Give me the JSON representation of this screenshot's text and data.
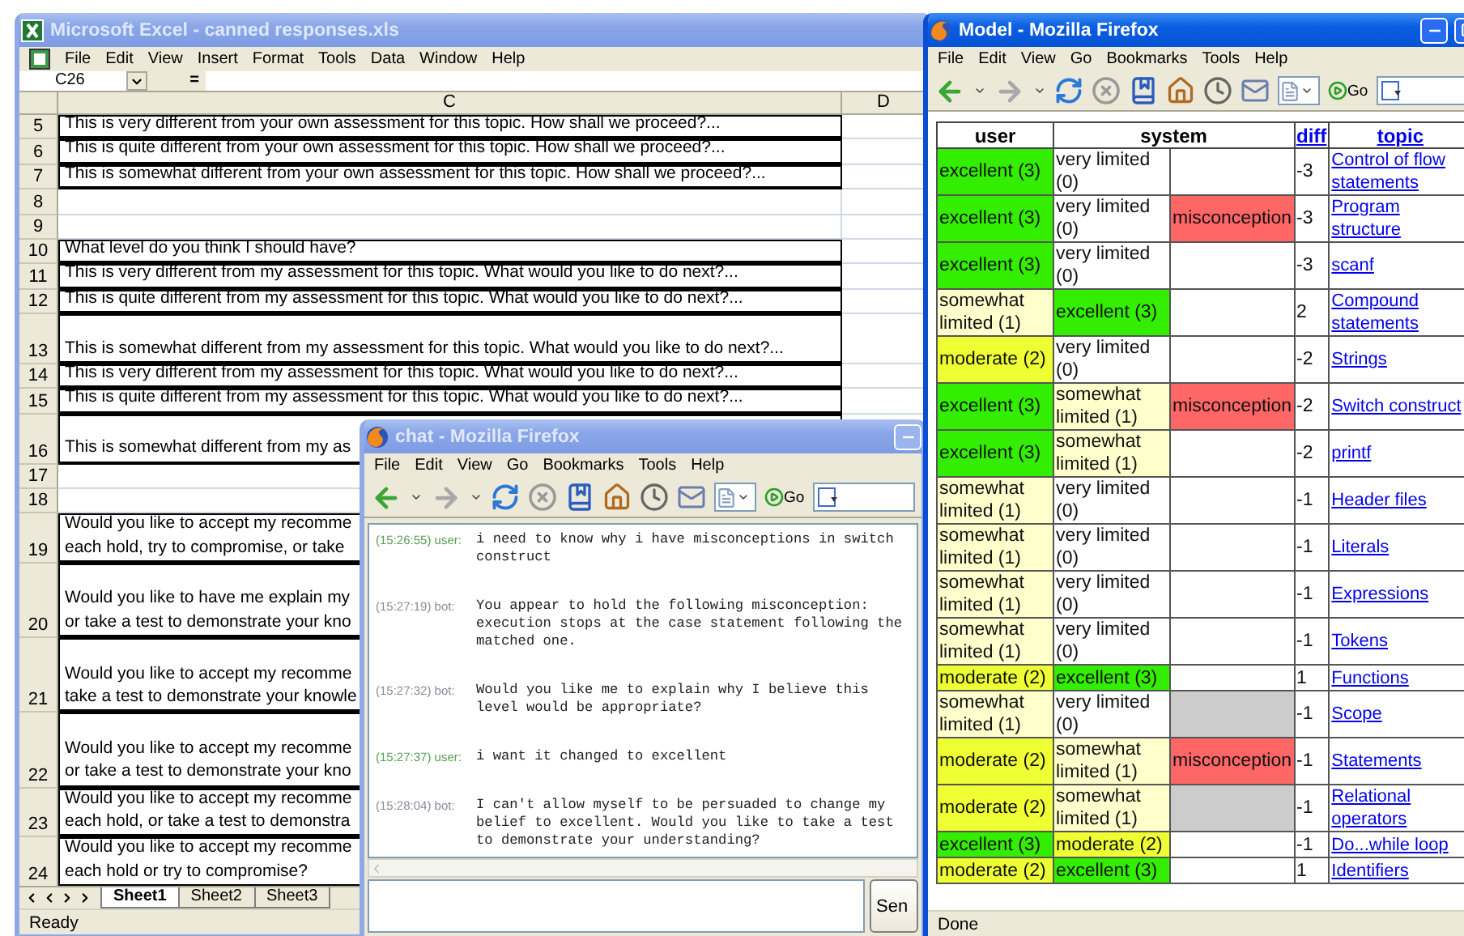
{
  "excel": {
    "title": "Microsoft Excel - canned responses.xls",
    "menu": [
      "File",
      "Edit",
      "View",
      "Insert",
      "Format",
      "Tools",
      "Data",
      "Window",
      "Help"
    ],
    "name_box": "C26",
    "formula_sign": "=",
    "columns": [
      "C",
      "D"
    ],
    "rows": [
      {
        "number": "5",
        "kind": "plain",
        "lines": [
          "This is very different from your own assessment for this topic. How shall we proceed?..."
        ]
      },
      {
        "number": "6",
        "kind": "plain",
        "lines": [
          "This is quite different from your own assessment for this topic. How shall we proceed?..."
        ]
      },
      {
        "number": "7",
        "kind": "plain",
        "lines": [
          "This is somewhat different from your own assessment for this topic. How shall we proceed?..."
        ]
      },
      {
        "number": "8",
        "kind": "plain"
      },
      {
        "number": "9",
        "kind": "plain"
      },
      {
        "number": "10",
        "kind": "plain",
        "lines": [
          "What level do you think I should have?"
        ]
      },
      {
        "number": "11",
        "kind": "plain",
        "lines": [
          "This is very different from my assessment for this topic. What would you like to do next?..."
        ]
      },
      {
        "number": "12",
        "kind": "plain",
        "lines": [
          "This is quite different from my assessment for this topic. What would you like to do next?..."
        ]
      },
      {
        "number": "13",
        "kind": "tall",
        "lines": [
          "This is somewhat different from my assessment for this topic. What would you like to do next?..."
        ]
      },
      {
        "number": "14",
        "kind": "plain",
        "lines": [
          "This is very different from my assessment for this topic. What would you like to do next?..."
        ]
      },
      {
        "number": "15",
        "kind": "plain",
        "lines": [
          "This is quite different from my assessment for this topic. What would you like to do next?..."
        ]
      },
      {
        "number": "16",
        "kind": "tall",
        "lines": [
          "This is somewhat different from my as"
        ]
      },
      {
        "number": "17",
        "kind": "plain"
      },
      {
        "number": "18",
        "kind": "plain"
      },
      {
        "number": "19",
        "kind": "plain",
        "lines": [
          "Would you like to accept my recomme",
          "each hold, try to compromise, or take"
        ]
      },
      {
        "number": "20",
        "kind": "tall",
        "lines": [
          "Would you like to have me explain my",
          "or take a test to demonstrate your kno"
        ]
      },
      {
        "number": "21",
        "kind": "tall",
        "lines": [
          "Would you like to accept my recomme",
          "take a test to demonstrate your knowle"
        ]
      },
      {
        "number": "22",
        "kind": "tall",
        "lines": [
          "Would you like to accept my recomme",
          "or take a test to demonstrate your kno"
        ]
      },
      {
        "number": "23",
        "kind": "plain",
        "lines": [
          "Would you like to accept my recomme",
          "each hold, or take a test to demonstra"
        ]
      },
      {
        "number": "24",
        "kind": "plain",
        "lines": [
          "Would you like to accept my recomme",
          "each hold or try to compromise?"
        ]
      }
    ],
    "sheets": [
      {
        "label": "Sheet1",
        "selected": true
      },
      {
        "label": "Sheet2",
        "selected": false
      },
      {
        "label": "Sheet3",
        "selected": false
      }
    ],
    "status": "Ready"
  },
  "chat": {
    "title": "chat - Mozilla Firefox",
    "menu": [
      "File",
      "Edit",
      "View",
      "Go",
      "Bookmarks",
      "Tools",
      "Help"
    ],
    "go": "Go",
    "messages": [
      {
        "time": "(15:26:55)",
        "speaker": "user:",
        "kind": "user",
        "text": "i need to know why i have misconceptions in switch construct"
      },
      {
        "time": "(15:27:19)",
        "speaker": "bot:",
        "kind": "bot",
        "text": "You appear to hold the following misconception: execution stops at the case statement following the matched one."
      },
      {
        "time": "(15:27:32)",
        "speaker": "bot:",
        "kind": "bot",
        "text": "Would you like me to explain why I believe this level would be appropriate?"
      },
      {
        "time": "(15:27:37)",
        "speaker": "user:",
        "kind": "user",
        "text": "i want it changed to excellent"
      },
      {
        "time": "(15:28:04)",
        "speaker": "bot:",
        "kind": "bot",
        "text": "I can't allow myself to be persuaded to change my belief to excellent. Would you like to take a test to demonstrate your understanding?"
      }
    ],
    "send": "Sen"
  },
  "model": {
    "title": "Model - Mozilla Firefox",
    "menu": [
      "File",
      "Edit",
      "View",
      "Go",
      "Bookmarks",
      "Tools",
      "Help"
    ],
    "go": "Go",
    "table": {
      "columns": [
        {
          "label": "user",
          "link": false
        },
        {
          "label": "system",
          "link": false
        },
        {
          "label": "diff",
          "link": true
        },
        {
          "label": "topic",
          "link": true
        }
      ],
      "rows": [
        {
          "user": {
            "text": "excellent (3)",
            "color": "#33ee00"
          },
          "system": {
            "text": "very limited (0)",
            "color": "#ffffff"
          },
          "diff": "-3",
          "topic": "Control of flow statements"
        },
        {
          "user": {
            "text": "excellent (3)",
            "color": "#33ee00"
          },
          "system": {
            "text": "very limited (0)",
            "color": "#ffffff"
          },
          "note": {
            "text": "misconception",
            "color": "#ff6666"
          },
          "diff": "-3",
          "topic": "Program structure"
        },
        {
          "user": {
            "text": "excellent (3)",
            "color": "#33ee00"
          },
          "system": {
            "text": "very limited (0)",
            "color": "#ffffff"
          },
          "diff": "-3",
          "topic": "scanf"
        },
        {
          "user": {
            "text": "somewhat limited (1)",
            "color": "#ffffcc"
          },
          "system": {
            "text": "excellent (3)",
            "color": "#33ee00"
          },
          "diff": "2",
          "topic": "Compound statements"
        },
        {
          "user": {
            "text": "moderate (2)",
            "color": "#eeff33"
          },
          "system": {
            "text": "very limited (0)",
            "color": "#ffffff"
          },
          "diff": "-2",
          "topic": "Strings"
        },
        {
          "user": {
            "text": "excellent (3)",
            "color": "#33ee00"
          },
          "system": {
            "text": "somewhat limited (1)",
            "color": "#ffffcc"
          },
          "note": {
            "text": "misconception",
            "color": "#ff6666"
          },
          "diff": "-2",
          "topic": "Switch construct"
        },
        {
          "user": {
            "text": "excellent (3)",
            "color": "#33ee00"
          },
          "system": {
            "text": "somewhat limited (1)",
            "color": "#ffffcc"
          },
          "diff": "-2",
          "topic": "printf"
        },
        {
          "user": {
            "text": "somewhat limited (1)",
            "color": "#ffffcc"
          },
          "system": {
            "text": "very limited (0)",
            "color": "#ffffff"
          },
          "diff": "-1",
          "topic": "Header files"
        },
        {
          "user": {
            "text": "somewhat limited (1)",
            "color": "#ffffcc"
          },
          "system": {
            "text": "very limited (0)",
            "color": "#ffffff"
          },
          "diff": "-1",
          "topic": "Literals"
        },
        {
          "user": {
            "text": "somewhat limited (1)",
            "color": "#ffffcc"
          },
          "system": {
            "text": "very limited (0)",
            "color": "#ffffff"
          },
          "diff": "-1",
          "topic": "Expressions"
        },
        {
          "user": {
            "text": "somewhat limited (1)",
            "color": "#ffffcc"
          },
          "system": {
            "text": "very limited (0)",
            "color": "#ffffff"
          },
          "diff": "-1",
          "topic": "Tokens"
        },
        {
          "user": {
            "text": "moderate (2)",
            "color": "#eeff33"
          },
          "system": {
            "text": "excellent (3)",
            "color": "#33ee00"
          },
          "diff": "1",
          "topic": "Functions"
        },
        {
          "user": {
            "text": "somewhat limited (1)",
            "color": "#ffffcc"
          },
          "system": {
            "text": "very limited (0)",
            "color": "#ffffff"
          },
          "note": {
            "color": "#cccccc"
          },
          "diff": "-1",
          "topic": "Scope"
        },
        {
          "user": {
            "text": "moderate (2)",
            "color": "#eeff33"
          },
          "system": {
            "text": "somewhat limited (1)",
            "color": "#ffffcc"
          },
          "note": {
            "text": "misconception",
            "color": "#ff6666"
          },
          "diff": "-1",
          "topic": "Statements"
        },
        {
          "user": {
            "text": "moderate (2)",
            "color": "#eeff33"
          },
          "system": {
            "text": "somewhat limited (1)",
            "color": "#ffffcc"
          },
          "note": {
            "color": "#cccccc"
          },
          "diff": "-1",
          "topic": "Relational operators"
        },
        {
          "user": {
            "text": "excellent (3)",
            "color": "#33ee00"
          },
          "system": {
            "text": "moderate (2)",
            "color": "#eeff33"
          },
          "diff": "-1",
          "topic": "Do...while loop"
        },
        {
          "user": {
            "text": "moderate (2)",
            "color": "#eeff33"
          },
          "system": {
            "text": "excellent (3)",
            "color": "#33ee00"
          },
          "diff": "1",
          "topic": "Identifiers"
        }
      ]
    },
    "status": "Done"
  }
}
